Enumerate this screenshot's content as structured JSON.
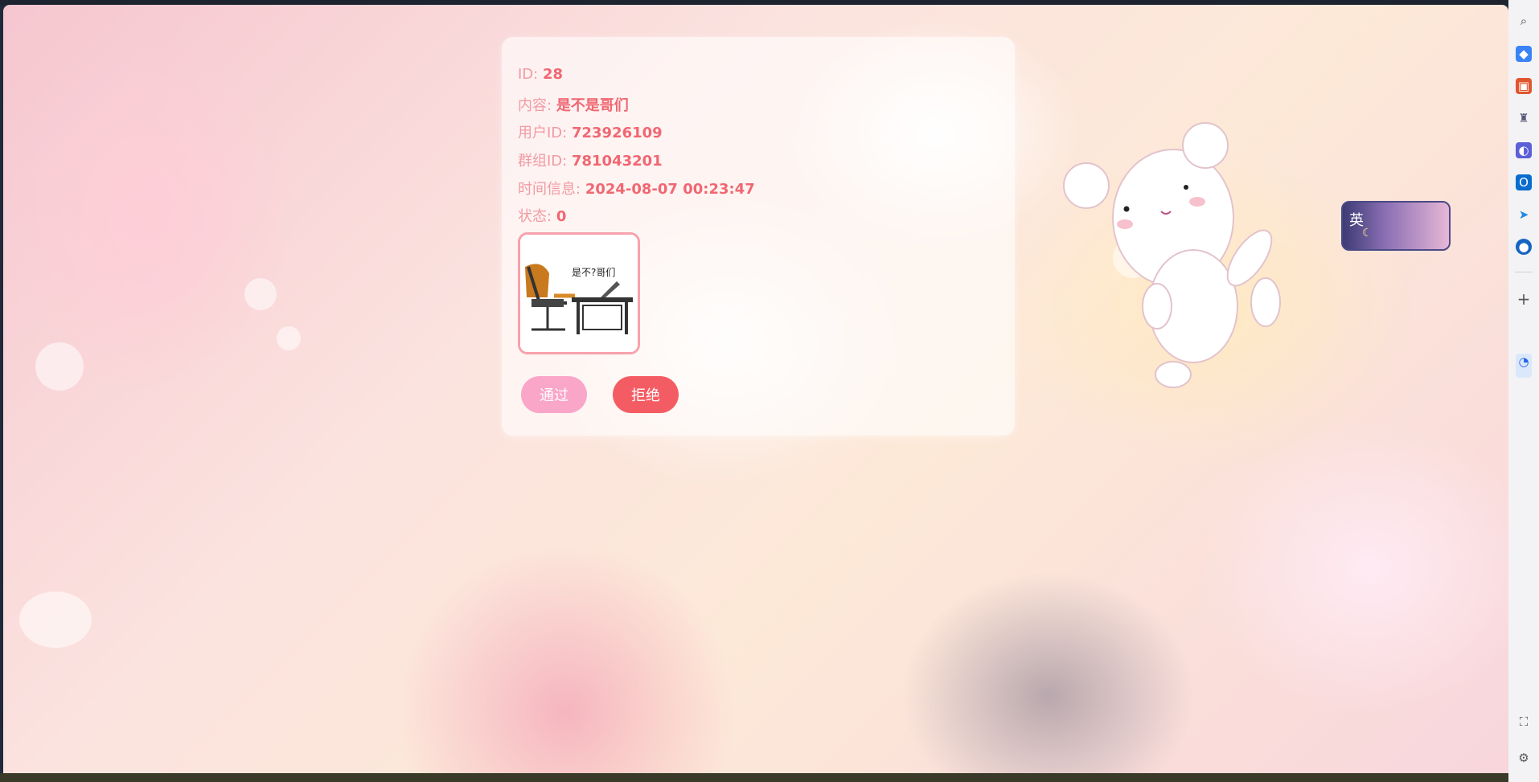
{
  "card": {
    "id_label": "ID:",
    "id_value": "28",
    "content_label": "内容:",
    "content_value": "是不是哥们",
    "user_label": "用户ID:",
    "user_value": "723926109",
    "group_label": "群组ID:",
    "group_value": "781043201",
    "time_label": "时间信息:",
    "time_value": "2024-08-07 00:23:47",
    "status_label": "状态:",
    "status_value": "0",
    "image_caption": "是不?哥们",
    "approve_label": "通过",
    "reject_label": "拒绝"
  },
  "ime": {
    "lang": "英",
    "moon": "☾"
  },
  "sidebar": {
    "icons": [
      "search-icon",
      "tag-icon",
      "toolbox-icon",
      "chess-icon",
      "copilot-icon",
      "outlook-icon",
      "send-icon",
      "app-icon",
      "add-icon",
      "notification-icon",
      "screenshot-icon",
      "settings-icon"
    ]
  },
  "colors": {
    "approve": "#f9a6c8",
    "reject": "#f45c63",
    "value_text": "#f06772"
  }
}
